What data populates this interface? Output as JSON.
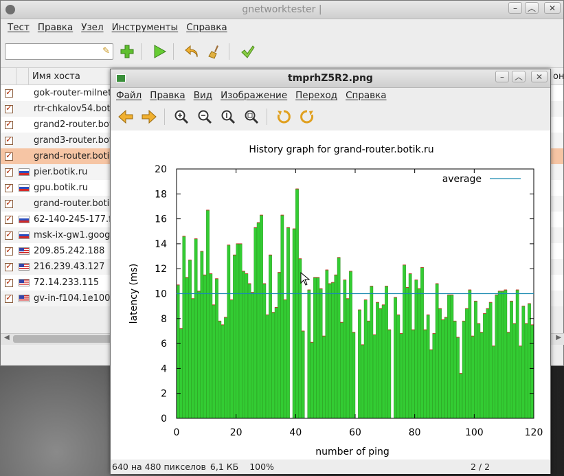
{
  "main_window": {
    "title": "gnetworktester |",
    "menu": [
      "Тест",
      "Правка",
      "Узел",
      "Инструменты",
      "Справка"
    ],
    "search_value": "",
    "columns": {
      "host": "Имя хоста",
      "overflow": "он"
    },
    "rows": [
      {
        "host": "gok-router-milnet",
        "flag": "none",
        "selected": false
      },
      {
        "host": "rtr-chkalov54.boti",
        "flag": "none",
        "selected": false
      },
      {
        "host": "grand2-router.boti",
        "flag": "none",
        "selected": false
      },
      {
        "host": "grand3-router.boti",
        "flag": "none",
        "selected": false
      },
      {
        "host": "grand-router.botik",
        "flag": "none",
        "selected": true
      },
      {
        "host": "pier.botik.ru",
        "flag": "ru",
        "selected": false
      },
      {
        "host": "gpu.botik.ru",
        "flag": "ru",
        "selected": false
      },
      {
        "host": "grand-router.botik",
        "flag": "none",
        "selected": false
      },
      {
        "host": "62-140-245-177.f",
        "flag": "ru",
        "selected": false
      },
      {
        "host": "msk-ix-gw1.googl",
        "flag": "ru",
        "selected": false
      },
      {
        "host": "209.85.242.188",
        "flag": "us",
        "selected": false
      },
      {
        "host": "216.239.43.127",
        "flag": "us",
        "selected": false
      },
      {
        "host": "72.14.233.115",
        "flag": "us",
        "selected": false
      },
      {
        "host": "gv-in-f104.1e100.",
        "flag": "us",
        "selected": false
      }
    ]
  },
  "viewer": {
    "title": "tmprhZ5R2.png",
    "menu": [
      "Файл",
      "Правка",
      "Вид",
      "Изображение",
      "Переход",
      "Справка"
    ],
    "status": {
      "size": "640 на 480 пикселов",
      "filesize": "6,1 КБ",
      "zoom": "100%",
      "page": "2 / 2"
    }
  },
  "chart_data": {
    "type": "bar",
    "title": "History graph for grand-router.botik.ru",
    "xlabel": "number of ping",
    "ylabel": "latency (ms)",
    "xlim": [
      0,
      120
    ],
    "ylim": [
      0,
      20
    ],
    "xticks": [
      0,
      20,
      40,
      60,
      80,
      100,
      120
    ],
    "yticks": [
      0,
      2,
      4,
      6,
      8,
      10,
      12,
      14,
      16,
      18,
      20
    ],
    "legend": {
      "label": "average",
      "position": "top-right"
    },
    "average": 10,
    "bar_color": "#33cc33",
    "average_color": "#1a8ab0",
    "values": [
      10.7,
      7.2,
      14.6,
      11.3,
      12.7,
      9.6,
      14.4,
      10.2,
      13.4,
      11.5,
      16.7,
      11.6,
      9.1,
      11.2,
      7.8,
      7.5,
      8.1,
      13.9,
      9.5,
      13.1,
      14,
      14,
      11.8,
      11.6,
      10.8,
      10.1,
      15.3,
      15.7,
      16.3,
      10.8,
      8.3,
      13.1,
      8.5,
      8.9,
      11.7,
      16.3,
      9.5,
      15.3,
      0,
      15.2,
      18.4,
      12.8,
      7,
      0,
      10.3,
      6.1,
      11.3,
      11.3,
      10.4,
      6.6,
      11.9,
      10.8,
      10.9,
      11.5,
      12.9,
      7.7,
      11.1,
      9.6,
      11.8,
      6.9,
      0,
      8.7,
      5.9,
      9.5,
      7.8,
      10.6,
      6.7,
      9.3,
      8.8,
      9.1,
      10.6,
      7.1,
      0,
      9.7,
      8.3,
      6.8,
      12.3,
      10.5,
      11.6,
      7.1,
      11.1,
      10.4,
      12.1,
      7.1,
      8.3,
      5.5,
      6.8,
      10.8,
      8.8,
      7.9,
      8.1,
      9.9,
      9.9,
      7.8,
      6.5,
      3.6,
      7.8,
      8.8,
      10.3,
      6.6,
      9.4,
      7.6,
      6.9,
      8.4,
      8.8,
      9.3,
      5.8,
      9.9,
      10.2,
      10.2,
      10.3,
      6.9,
      9.4,
      7.6,
      10.3,
      5.8,
      9.0,
      7.6,
      9.2,
      7.5
    ]
  }
}
